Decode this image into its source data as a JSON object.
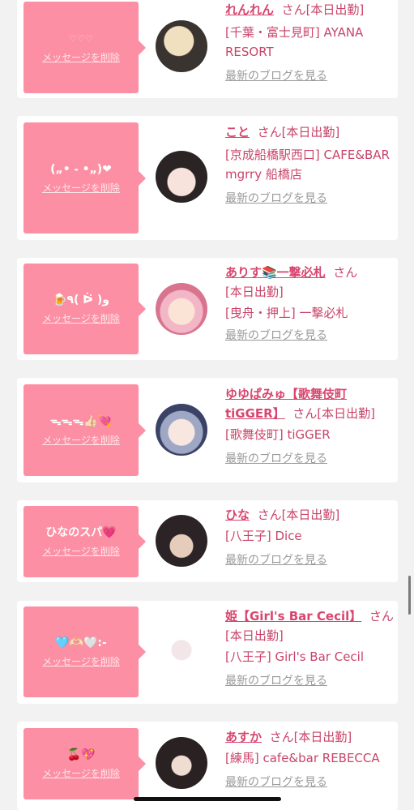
{
  "cards": [
    {
      "message": "♡♡♡",
      "delete_label": "メッセージを削除",
      "name": "れんれん",
      "san": "さん",
      "status": "[本日出勤]",
      "shop": "[千葉・富士見町] AYANA RESORT",
      "blog_label": "最新のブログを見る"
    },
    {
      "message": "(„• ֊ •„)❤︎",
      "delete_label": "メッセージを削除",
      "name": "こと",
      "san": "さん",
      "status": "[本日出勤]",
      "shop": "[京成船橋駅西口] CAFE&BAR mgrry 船橋店",
      "blog_label": "最新のブログを見る"
    },
    {
      "message": "🍺٩( ᐖ )و",
      "delete_label": "メッセージを削除",
      "name": "ありす📚一撃必札",
      "san": "さん",
      "status": "[本日出勤]",
      "shop": "[曳舟・押上] 一撃必札",
      "blog_label": "最新のブログを見る"
    },
    {
      "message": "ᯓᯓᯓ👍🏻💘",
      "delete_label": "メッセージを削除",
      "name": "ゆゆぱみゅ【歌舞伎町tiGGER】",
      "san": "さん",
      "status": "[本日出勤]",
      "shop": "[歌舞伎町] tiGGER",
      "blog_label": "最新のブログを見る"
    },
    {
      "message": "ひなのスパ💗",
      "delete_label": "メッセージを削除",
      "name": "ひな",
      "san": "さん",
      "status": "[本日出勤]",
      "shop": "[八王子] Dice",
      "blog_label": "最新のブログを見る"
    },
    {
      "message": "🩵🫶🏻🤍:-",
      "delete_label": "メッセージを削除",
      "name": "姫【Girl's Bar Cecil】",
      "san": "さん",
      "status": "[本日出勤]",
      "shop": "[八王子] Girl's Bar Cecil",
      "blog_label": "最新のブログを見る"
    },
    {
      "message": "🍒💖",
      "delete_label": "メッセージを削除",
      "name": "あすか",
      "san": "さん",
      "status": "[本日出勤]",
      "shop": "[練馬] cafe&bar REBECCA",
      "blog_label": "最新のブログを見る"
    }
  ],
  "colors": {
    "accent": "#fc8fa3",
    "name": "#d8466f",
    "text": "#c9446a",
    "muted": "#9a9a9a"
  }
}
